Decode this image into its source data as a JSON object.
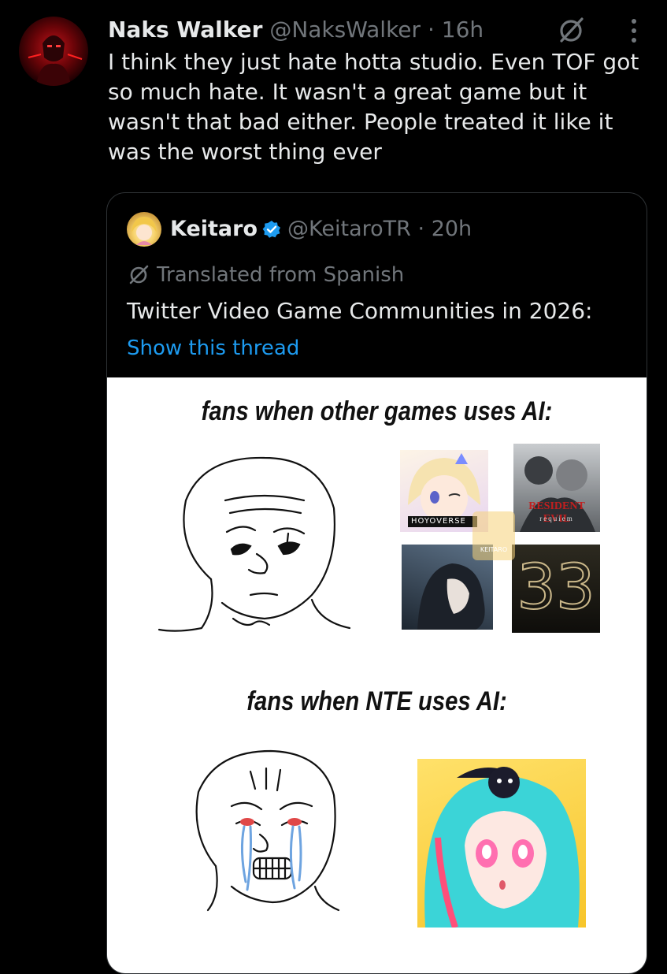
{
  "tweet": {
    "author_name": "Naks Walker",
    "author_handle": "@NaksWalker",
    "separator": "·",
    "time": "16h",
    "text": "I think they just hate hotta studio. Even TOF got so much hate. It wasn't a great game but it wasn't that bad either. People treated it like it was the worst thing ever"
  },
  "quote": {
    "author_name": "Keitaro",
    "author_handle": "@KeitaroTR",
    "separator": "·",
    "time": "20h",
    "translated_label": "Translated from Spanish",
    "text": "Twitter Video Game Communities in 2026:",
    "show_thread": "Show this thread"
  },
  "meme": {
    "caption_top": "fans when other games uses AI:",
    "caption_bottom": "fans when NTE uses AI:",
    "tile_labels": {
      "hoyoverse": "HOYOVERSE",
      "resident_evil": "RESIDENT EVIL",
      "requiem": "requiem",
      "expedition": "33",
      "watermark": "KEITARO"
    }
  },
  "colors": {
    "background": "#000000",
    "text_primary": "#e7e9ea",
    "text_muted": "#71767b",
    "link": "#1d9bf0",
    "border": "#2f3336"
  },
  "icons": [
    "grok-icon",
    "more-options-icon",
    "verified-badge-icon",
    "translate-icon"
  ]
}
